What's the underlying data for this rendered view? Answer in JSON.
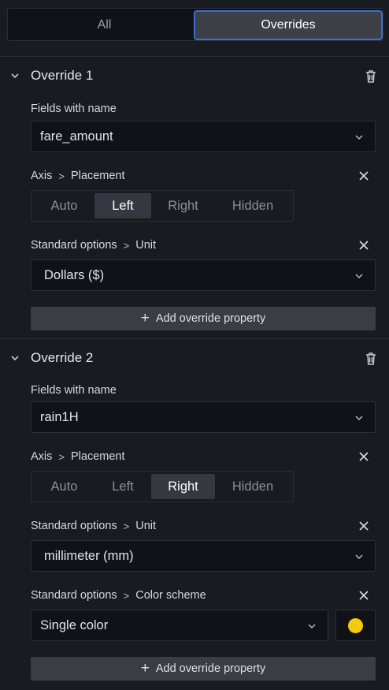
{
  "tabs": {
    "all": "All",
    "overrides": "Overrides",
    "active": "overrides"
  },
  "overrides": [
    {
      "title": "Override 1",
      "matcher_label": "Fields with name",
      "matcher_value": "fare_amount",
      "props": [
        {
          "category": "Axis",
          "name": "Placement",
          "type": "radio",
          "options": [
            "Auto",
            "Left",
            "Right",
            "Hidden"
          ],
          "selected": "Left"
        },
        {
          "category": "Standard options",
          "name": "Unit",
          "type": "select",
          "value": "Dollars ($)"
        }
      ],
      "add_label": "Add override property"
    },
    {
      "title": "Override 2",
      "matcher_label": "Fields with name",
      "matcher_value": "rain1H",
      "props": [
        {
          "category": "Axis",
          "name": "Placement",
          "type": "radio",
          "options": [
            "Auto",
            "Left",
            "Right",
            "Hidden"
          ],
          "selected": "Right"
        },
        {
          "category": "Standard options",
          "name": "Unit",
          "type": "select",
          "value": "millimeter (mm)"
        },
        {
          "category": "Standard options",
          "name": "Color scheme",
          "type": "select",
          "value": "Single color",
          "swatch_color": "#f2cc0c"
        }
      ],
      "add_label": "Add override property"
    }
  ],
  "icons": {
    "collapse": "chevron-down-icon",
    "delete": "trash-icon",
    "remove": "close-icon",
    "dropdown": "chevron-down-icon",
    "add": "plus-icon"
  },
  "colors": {
    "accent": "#3e6ed4",
    "background": "#181b1f",
    "input_bg": "#111217"
  }
}
